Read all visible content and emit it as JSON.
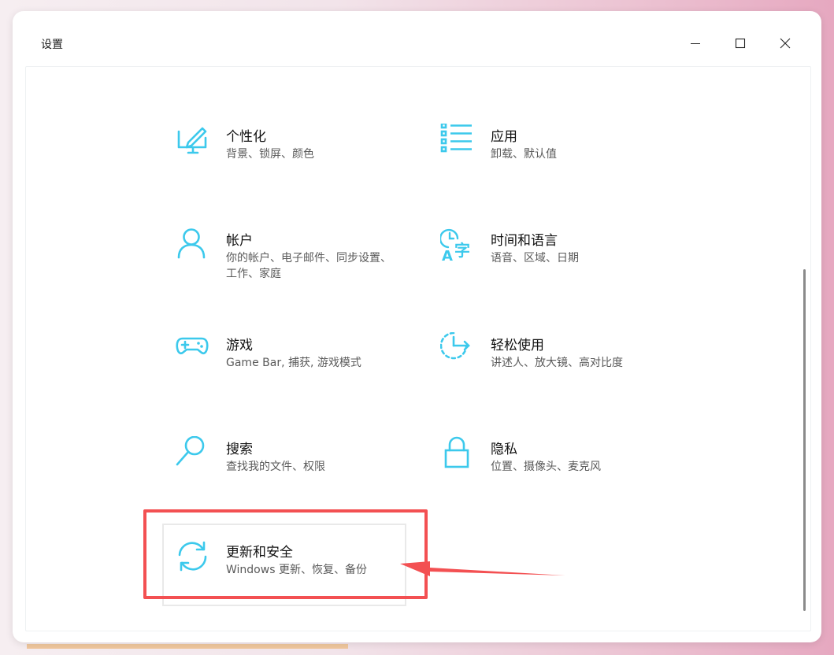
{
  "window": {
    "title": "设置"
  },
  "controls": {
    "minimize": "minimize-icon",
    "maximize": "maximize-icon",
    "close": "close-icon"
  },
  "tiles": [
    {
      "id": "personalization",
      "name": "个性化",
      "desc": "背景、锁屏、颜色",
      "icon": "personalization-icon"
    },
    {
      "id": "apps",
      "name": "应用",
      "desc": "卸载、默认值",
      "icon": "apps-icon"
    },
    {
      "id": "accounts",
      "name": "帐户",
      "desc": "你的帐户、电子邮件、同步设置、工作、家庭",
      "icon": "account-icon"
    },
    {
      "id": "time-language",
      "name": "时间和语言",
      "desc": "语音、区域、日期",
      "icon": "time-language-icon"
    },
    {
      "id": "gaming",
      "name": "游戏",
      "desc": "Game Bar, 捕获, 游戏模式",
      "icon": "gamepad-icon"
    },
    {
      "id": "ease-of-access",
      "name": "轻松使用",
      "desc": "讲述人、放大镜、高对比度",
      "icon": "ease-of-access-icon"
    },
    {
      "id": "search",
      "name": "搜索",
      "desc": "查找我的文件、权限",
      "icon": "search-icon"
    },
    {
      "id": "privacy",
      "name": "隐私",
      "desc": "位置、摄像头、麦克风",
      "icon": "lock-icon"
    },
    {
      "id": "update-security",
      "name": "更新和安全",
      "desc": "Windows 更新、恢复、备份",
      "icon": "refresh-icon"
    }
  ],
  "colors": {
    "accent": "#3cc9ec",
    "annotation": "#f35052"
  }
}
